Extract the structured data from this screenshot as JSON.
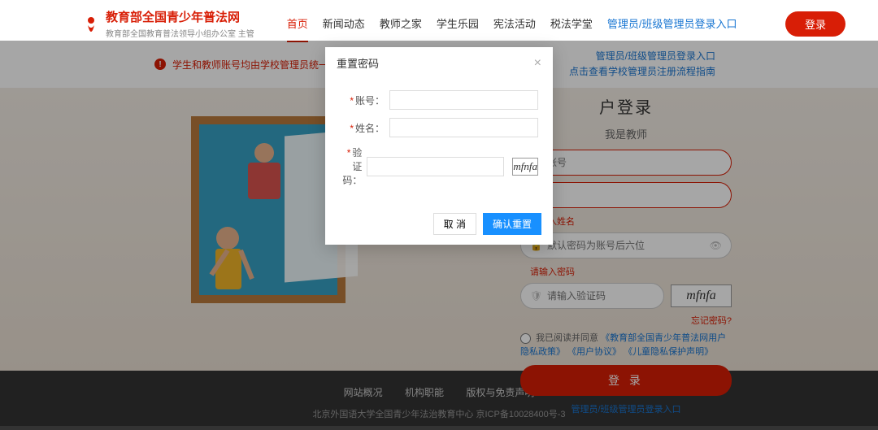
{
  "header": {
    "brand_title": "教育部全国青少年普法网",
    "brand_sub": "教育部全国教育普法领导小组办公室 主管",
    "login_btn": "登录"
  },
  "nav": {
    "home": "首页",
    "news": "新闻动态",
    "teacher": "教师之家",
    "student": "学生乐园",
    "const": "宪法活动",
    "tax": "税法学堂",
    "admin": "管理员/班级管理员登录入口"
  },
  "notice": {
    "msg": "学生和教师账号均由学校管理员统一生成，无需注册",
    "admin_link": "管理员/班级管理员登录入口",
    "guide_link": "点击查看学校管理员注册流程指南"
  },
  "login": {
    "title": "户登录",
    "sub": "我是教师",
    "ph_phone": "账号",
    "ph_name": "",
    "hint_name": "请输入姓名",
    "ph_pw": "默认密码为账号后六位",
    "hint_pw": "请输入密码",
    "ph_captcha": "请输入验证码",
    "captcha_text": "mfnfa",
    "forgot": "忘记密码?",
    "agree_prefix": "我已阅读并同意",
    "agree_link1": "《教育部全国青少年普法网用户隐私政策》",
    "agree_link2": "《用户协议》",
    "agree_link3": "《儿童隐私保护声明》",
    "submit": "登 录",
    "admin_login": "管理员/班级管理员登录入口"
  },
  "footer": {
    "link1": "网站概况",
    "link2": "机构职能",
    "link3": "版权与免责声明",
    "copy": "北京外国语大学全国青少年法治教育中心 京ICP备10028400号-3"
  },
  "modal": {
    "title": "重置密码",
    "lbl_account": "账号：",
    "lbl_name": "姓名：",
    "lbl_captcha": "验证码：",
    "captcha_text": "mfnfa",
    "cancel": "取 消",
    "confirm": "确认重置"
  }
}
